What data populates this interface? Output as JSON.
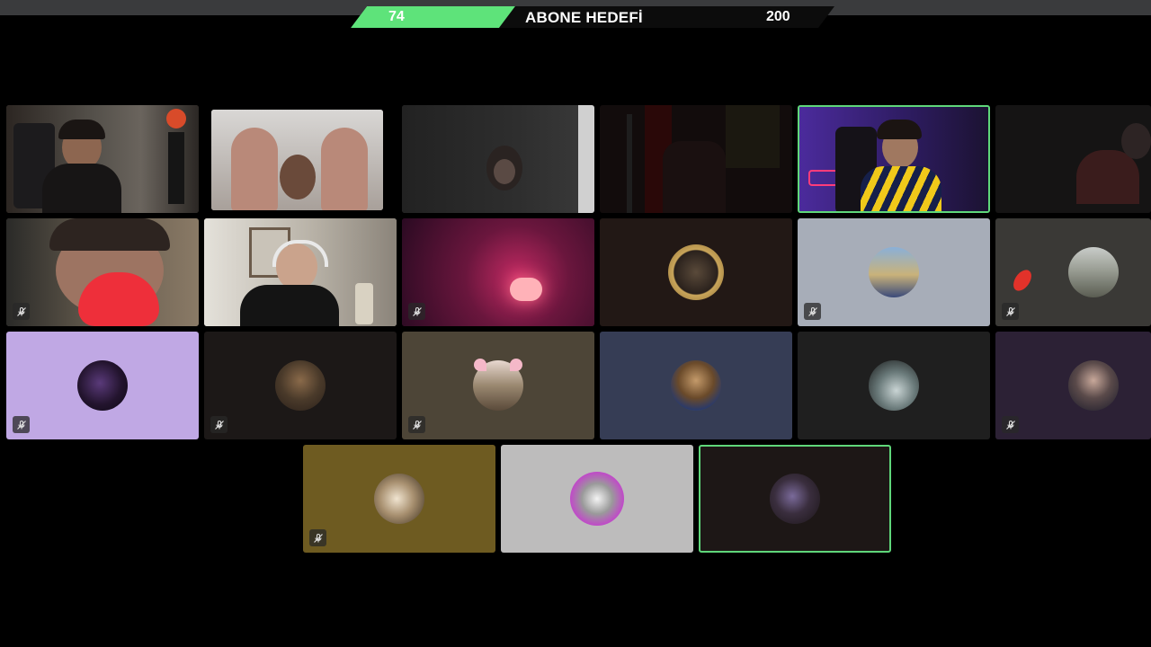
{
  "goal": {
    "current": "74",
    "title": "ABONE HEDEFİ",
    "target": "200",
    "fill_fraction": 0.34
  },
  "colors": {
    "goal_fill": "#5ee37a",
    "speaking_border": "#5fd77a",
    "topbar": "#3a3b3d"
  },
  "icons": {
    "mute": "microphone-slash-icon"
  }
}
